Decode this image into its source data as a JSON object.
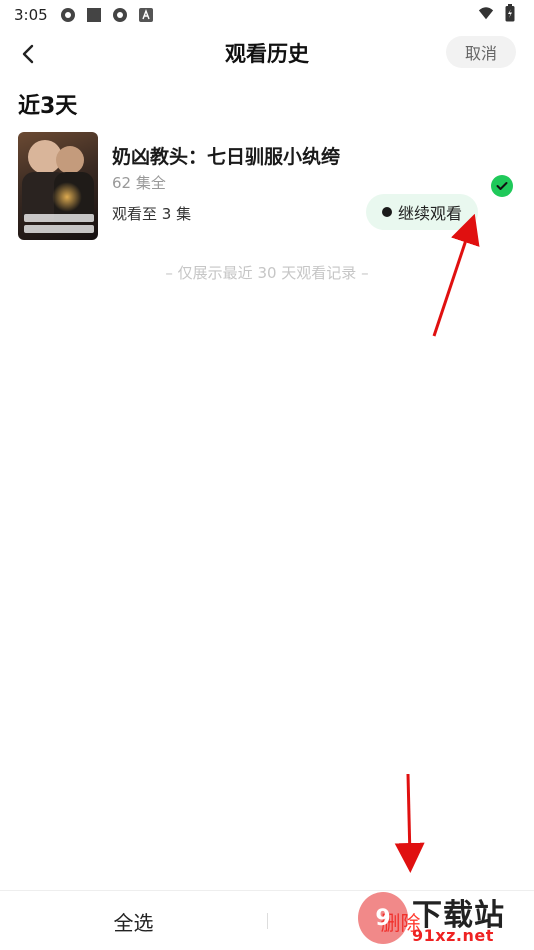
{
  "status_bar": {
    "time": "3:05",
    "left_icons": [
      "aperture-icon",
      "square-icon",
      "aperture-icon",
      "font-icon"
    ],
    "right_icons": [
      "wifi-icon",
      "battery-icon"
    ]
  },
  "header": {
    "title": "观看历史",
    "cancel_label": "取消",
    "back_icon": "chevron-left-icon"
  },
  "section": {
    "title": "近3天"
  },
  "history_items": [
    {
      "title": "奶凶教头：七日驯服小纨绔",
      "episodes": "62 集全",
      "progress": "观看至 3 集",
      "continue_label": "继续观看",
      "selected": true
    }
  ],
  "footer_note": "– 仅展示最近 30 天观看记录 –",
  "bottom_bar": {
    "select_all_label": "全选",
    "delete_label": "删除"
  },
  "watermark": {
    "badge": "9",
    "text": "下载站",
    "url": "91xz.net"
  },
  "colors": {
    "accent_green": "#1fc95a",
    "continue_bg": "#e9f8ef",
    "delete_red": "#ff3b30",
    "annotation_red": "#e01010"
  }
}
